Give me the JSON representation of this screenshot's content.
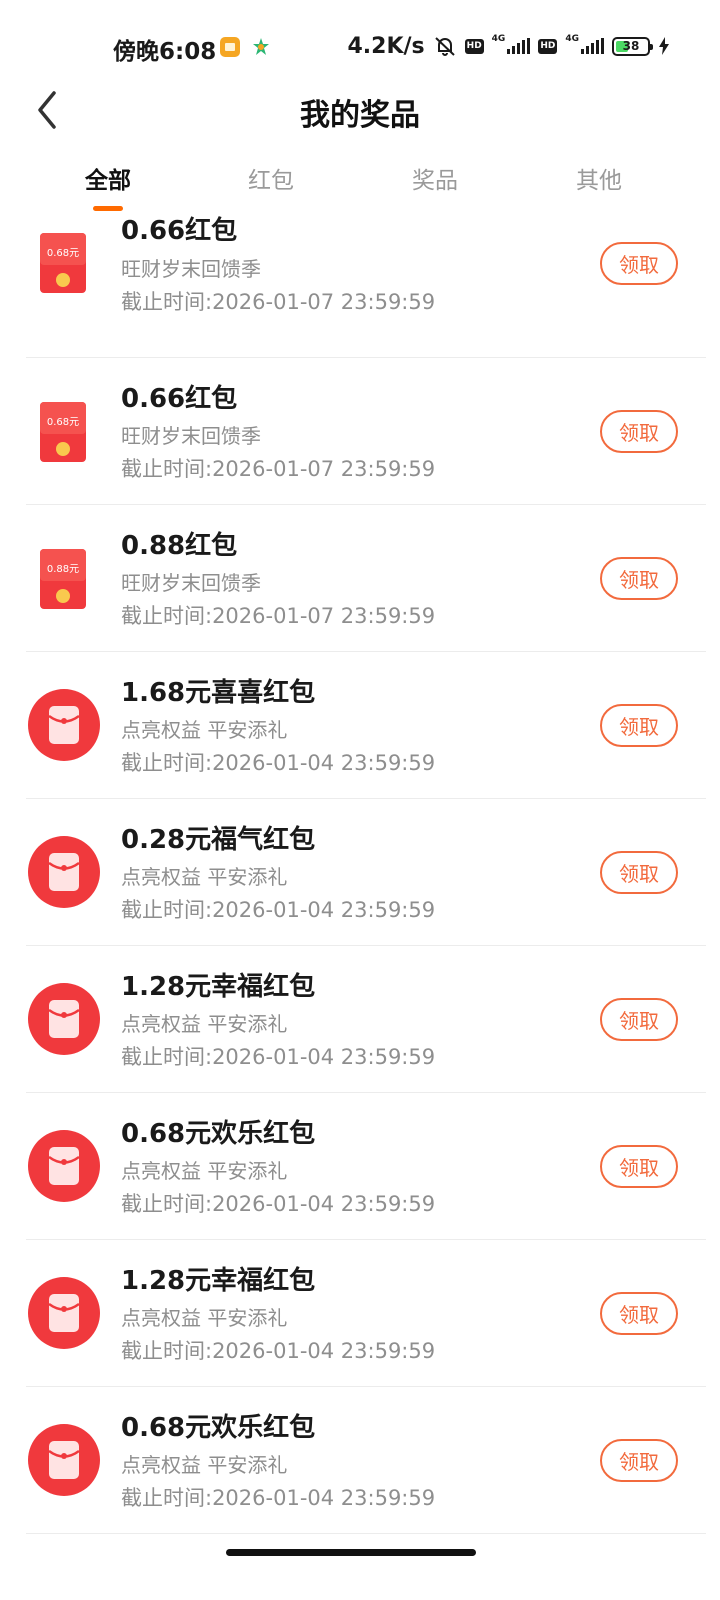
{
  "status_bar": {
    "time": "傍晚6:08",
    "speed": "4.2K/s",
    "hd_badge": "HD",
    "network": "4G",
    "battery": "38"
  },
  "header": {
    "title": "我的奖品"
  },
  "tabs": [
    {
      "label": "全部",
      "active": true
    },
    {
      "label": "红包",
      "active": false
    },
    {
      "label": "奖品",
      "active": false
    },
    {
      "label": "其他",
      "active": false
    }
  ],
  "items": [
    {
      "title": "0.66红包",
      "source": "旺财岁末回馈季",
      "expire": "截止时间:2026-01-07 23:59:59",
      "button": "领取",
      "icon": "envelope-card-icon",
      "icon_value": "0.68元"
    },
    {
      "title": "0.66红包",
      "source": "旺财岁末回馈季",
      "expire": "截止时间:2026-01-07 23:59:59",
      "button": "领取",
      "icon": "envelope-card-icon",
      "icon_value": "0.68元"
    },
    {
      "title": "0.88红包",
      "source": "旺财岁末回馈季",
      "expire": "截止时间:2026-01-07 23:59:59",
      "button": "领取",
      "icon": "envelope-card-icon",
      "icon_value": "0.88元"
    },
    {
      "title": "1.68元喜喜红包",
      "source": "点亮权益 平安添礼",
      "expire": "截止时间:2026-01-04 23:59:59",
      "button": "领取",
      "icon": "red-envelope-round-icon"
    },
    {
      "title": "0.28元福气红包",
      "source": "点亮权益 平安添礼",
      "expire": "截止时间:2026-01-04 23:59:59",
      "button": "领取",
      "icon": "red-envelope-round-icon"
    },
    {
      "title": "1.28元幸福红包",
      "source": "点亮权益 平安添礼",
      "expire": "截止时间:2026-01-04 23:59:59",
      "button": "领取",
      "icon": "red-envelope-round-icon"
    },
    {
      "title": "0.68元欢乐红包",
      "source": "点亮权益 平安添礼",
      "expire": "截止时间:2026-01-04 23:59:59",
      "button": "领取",
      "icon": "red-envelope-round-icon"
    },
    {
      "title": "1.28元幸福红包",
      "source": "点亮权益 平安添礼",
      "expire": "截止时间:2026-01-04 23:59:59",
      "button": "领取",
      "icon": "red-envelope-round-icon"
    },
    {
      "title": "0.68元欢乐红包",
      "source": "点亮权益 平安添礼",
      "expire": "截止时间:2026-01-04 23:59:59",
      "button": "领取",
      "icon": "red-envelope-round-icon"
    }
  ],
  "colors": {
    "accent": "#f26a3d",
    "tab_indicator": "#ff6a00",
    "envelope_red": "#f0393d"
  }
}
